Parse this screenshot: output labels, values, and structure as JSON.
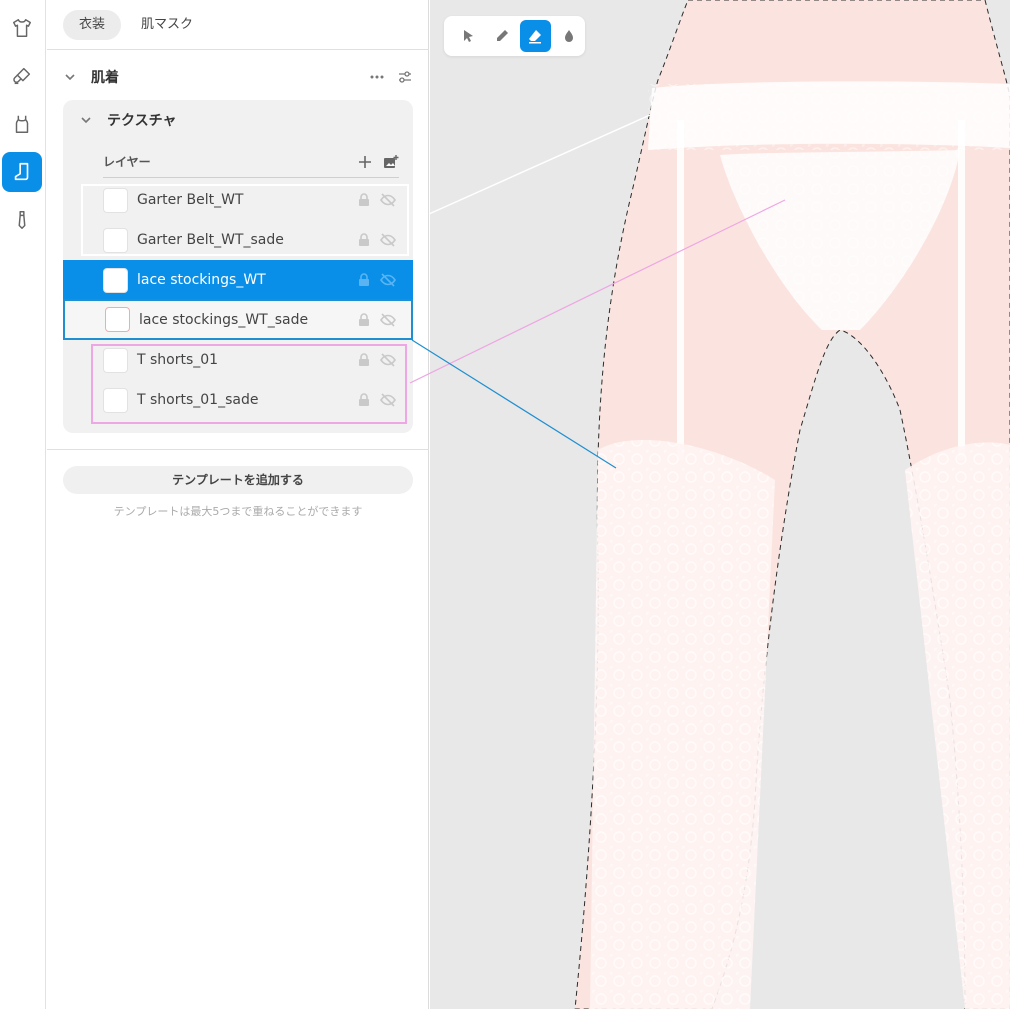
{
  "rail": {
    "items": [
      {
        "icon": "shirt-icon",
        "active": false
      },
      {
        "icon": "paint-brush-icon",
        "active": false
      },
      {
        "icon": "tank-top-icon",
        "active": false
      },
      {
        "icon": "sock-icon",
        "active": true
      },
      {
        "icon": "tie-icon",
        "active": false
      }
    ]
  },
  "panel": {
    "tabs": [
      {
        "label": "衣装",
        "active": true
      },
      {
        "label": "肌マスク",
        "active": false
      }
    ],
    "section": {
      "title": "肌着",
      "more_icon": "more-icon",
      "settings_icon": "sliders-icon"
    },
    "texture": {
      "title": "テクスチャ",
      "layers_label": "レイヤー",
      "add_icon": "plus-icon",
      "add_image_icon": "add-image-icon",
      "layers": [
        {
          "name": "Garter Belt_WT",
          "state": "normal"
        },
        {
          "name": "Garter Belt_WT_sade",
          "state": "normal"
        },
        {
          "name": "lace stockings_WT",
          "state": "selected"
        },
        {
          "name": "lace stockings_WT_sade",
          "state": "outlined"
        },
        {
          "name": "T shorts_01",
          "state": "normal"
        },
        {
          "name": "T shorts_01_sade",
          "state": "normal"
        }
      ]
    },
    "template": {
      "button_label": "テンプレートを追加する",
      "note": "テンプレートは最大5つまで重ねることができます"
    }
  },
  "toolbar": {
    "tools": [
      {
        "icon": "pointer-icon",
        "active": false
      },
      {
        "icon": "pencil-icon",
        "active": false
      },
      {
        "icon": "eraser-icon",
        "active": true
      },
      {
        "icon": "drop-icon",
        "active": false
      }
    ]
  },
  "colors": {
    "accent": "#0a8fe8",
    "outline_blue": "#1e8fd0",
    "group_pink": "#efa6e4",
    "canvas_bg": "#e8e8e8"
  }
}
